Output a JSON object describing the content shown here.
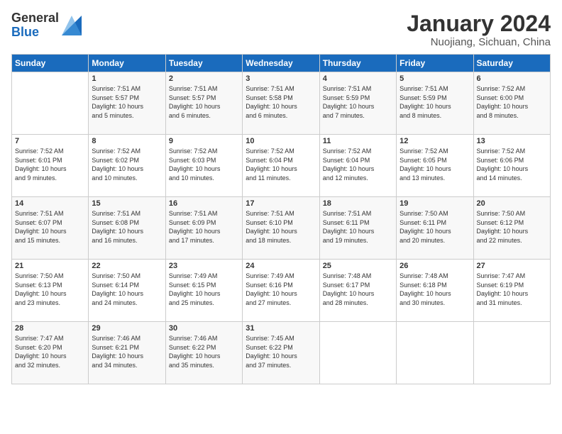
{
  "logo": {
    "general": "General",
    "blue": "Blue"
  },
  "title": "January 2024",
  "location": "Nuojiang, Sichuan, China",
  "headers": [
    "Sunday",
    "Monday",
    "Tuesday",
    "Wednesday",
    "Thursday",
    "Friday",
    "Saturday"
  ],
  "weeks": [
    [
      {
        "day": "",
        "info": ""
      },
      {
        "day": "1",
        "info": "Sunrise: 7:51 AM\nSunset: 5:57 PM\nDaylight: 10 hours\nand 5 minutes."
      },
      {
        "day": "2",
        "info": "Sunrise: 7:51 AM\nSunset: 5:57 PM\nDaylight: 10 hours\nand 6 minutes."
      },
      {
        "day": "3",
        "info": "Sunrise: 7:51 AM\nSunset: 5:58 PM\nDaylight: 10 hours\nand 6 minutes."
      },
      {
        "day": "4",
        "info": "Sunrise: 7:51 AM\nSunset: 5:59 PM\nDaylight: 10 hours\nand 7 minutes."
      },
      {
        "day": "5",
        "info": "Sunrise: 7:51 AM\nSunset: 5:59 PM\nDaylight: 10 hours\nand 8 minutes."
      },
      {
        "day": "6",
        "info": "Sunrise: 7:52 AM\nSunset: 6:00 PM\nDaylight: 10 hours\nand 8 minutes."
      }
    ],
    [
      {
        "day": "7",
        "info": "Sunrise: 7:52 AM\nSunset: 6:01 PM\nDaylight: 10 hours\nand 9 minutes."
      },
      {
        "day": "8",
        "info": "Sunrise: 7:52 AM\nSunset: 6:02 PM\nDaylight: 10 hours\nand 10 minutes."
      },
      {
        "day": "9",
        "info": "Sunrise: 7:52 AM\nSunset: 6:03 PM\nDaylight: 10 hours\nand 10 minutes."
      },
      {
        "day": "10",
        "info": "Sunrise: 7:52 AM\nSunset: 6:04 PM\nDaylight: 10 hours\nand 11 minutes."
      },
      {
        "day": "11",
        "info": "Sunrise: 7:52 AM\nSunset: 6:04 PM\nDaylight: 10 hours\nand 12 minutes."
      },
      {
        "day": "12",
        "info": "Sunrise: 7:52 AM\nSunset: 6:05 PM\nDaylight: 10 hours\nand 13 minutes."
      },
      {
        "day": "13",
        "info": "Sunrise: 7:52 AM\nSunset: 6:06 PM\nDaylight: 10 hours\nand 14 minutes."
      }
    ],
    [
      {
        "day": "14",
        "info": "Sunrise: 7:51 AM\nSunset: 6:07 PM\nDaylight: 10 hours\nand 15 minutes."
      },
      {
        "day": "15",
        "info": "Sunrise: 7:51 AM\nSunset: 6:08 PM\nDaylight: 10 hours\nand 16 minutes."
      },
      {
        "day": "16",
        "info": "Sunrise: 7:51 AM\nSunset: 6:09 PM\nDaylight: 10 hours\nand 17 minutes."
      },
      {
        "day": "17",
        "info": "Sunrise: 7:51 AM\nSunset: 6:10 PM\nDaylight: 10 hours\nand 18 minutes."
      },
      {
        "day": "18",
        "info": "Sunrise: 7:51 AM\nSunset: 6:11 PM\nDaylight: 10 hours\nand 19 minutes."
      },
      {
        "day": "19",
        "info": "Sunrise: 7:50 AM\nSunset: 6:11 PM\nDaylight: 10 hours\nand 20 minutes."
      },
      {
        "day": "20",
        "info": "Sunrise: 7:50 AM\nSunset: 6:12 PM\nDaylight: 10 hours\nand 22 minutes."
      }
    ],
    [
      {
        "day": "21",
        "info": "Sunrise: 7:50 AM\nSunset: 6:13 PM\nDaylight: 10 hours\nand 23 minutes."
      },
      {
        "day": "22",
        "info": "Sunrise: 7:50 AM\nSunset: 6:14 PM\nDaylight: 10 hours\nand 24 minutes."
      },
      {
        "day": "23",
        "info": "Sunrise: 7:49 AM\nSunset: 6:15 PM\nDaylight: 10 hours\nand 25 minutes."
      },
      {
        "day": "24",
        "info": "Sunrise: 7:49 AM\nSunset: 6:16 PM\nDaylight: 10 hours\nand 27 minutes."
      },
      {
        "day": "25",
        "info": "Sunrise: 7:48 AM\nSunset: 6:17 PM\nDaylight: 10 hours\nand 28 minutes."
      },
      {
        "day": "26",
        "info": "Sunrise: 7:48 AM\nSunset: 6:18 PM\nDaylight: 10 hours\nand 30 minutes."
      },
      {
        "day": "27",
        "info": "Sunrise: 7:47 AM\nSunset: 6:19 PM\nDaylight: 10 hours\nand 31 minutes."
      }
    ],
    [
      {
        "day": "28",
        "info": "Sunrise: 7:47 AM\nSunset: 6:20 PM\nDaylight: 10 hours\nand 32 minutes."
      },
      {
        "day": "29",
        "info": "Sunrise: 7:46 AM\nSunset: 6:21 PM\nDaylight: 10 hours\nand 34 minutes."
      },
      {
        "day": "30",
        "info": "Sunrise: 7:46 AM\nSunset: 6:22 PM\nDaylight: 10 hours\nand 35 minutes."
      },
      {
        "day": "31",
        "info": "Sunrise: 7:45 AM\nSunset: 6:22 PM\nDaylight: 10 hours\nand 37 minutes."
      },
      {
        "day": "",
        "info": ""
      },
      {
        "day": "",
        "info": ""
      },
      {
        "day": "",
        "info": ""
      }
    ]
  ]
}
